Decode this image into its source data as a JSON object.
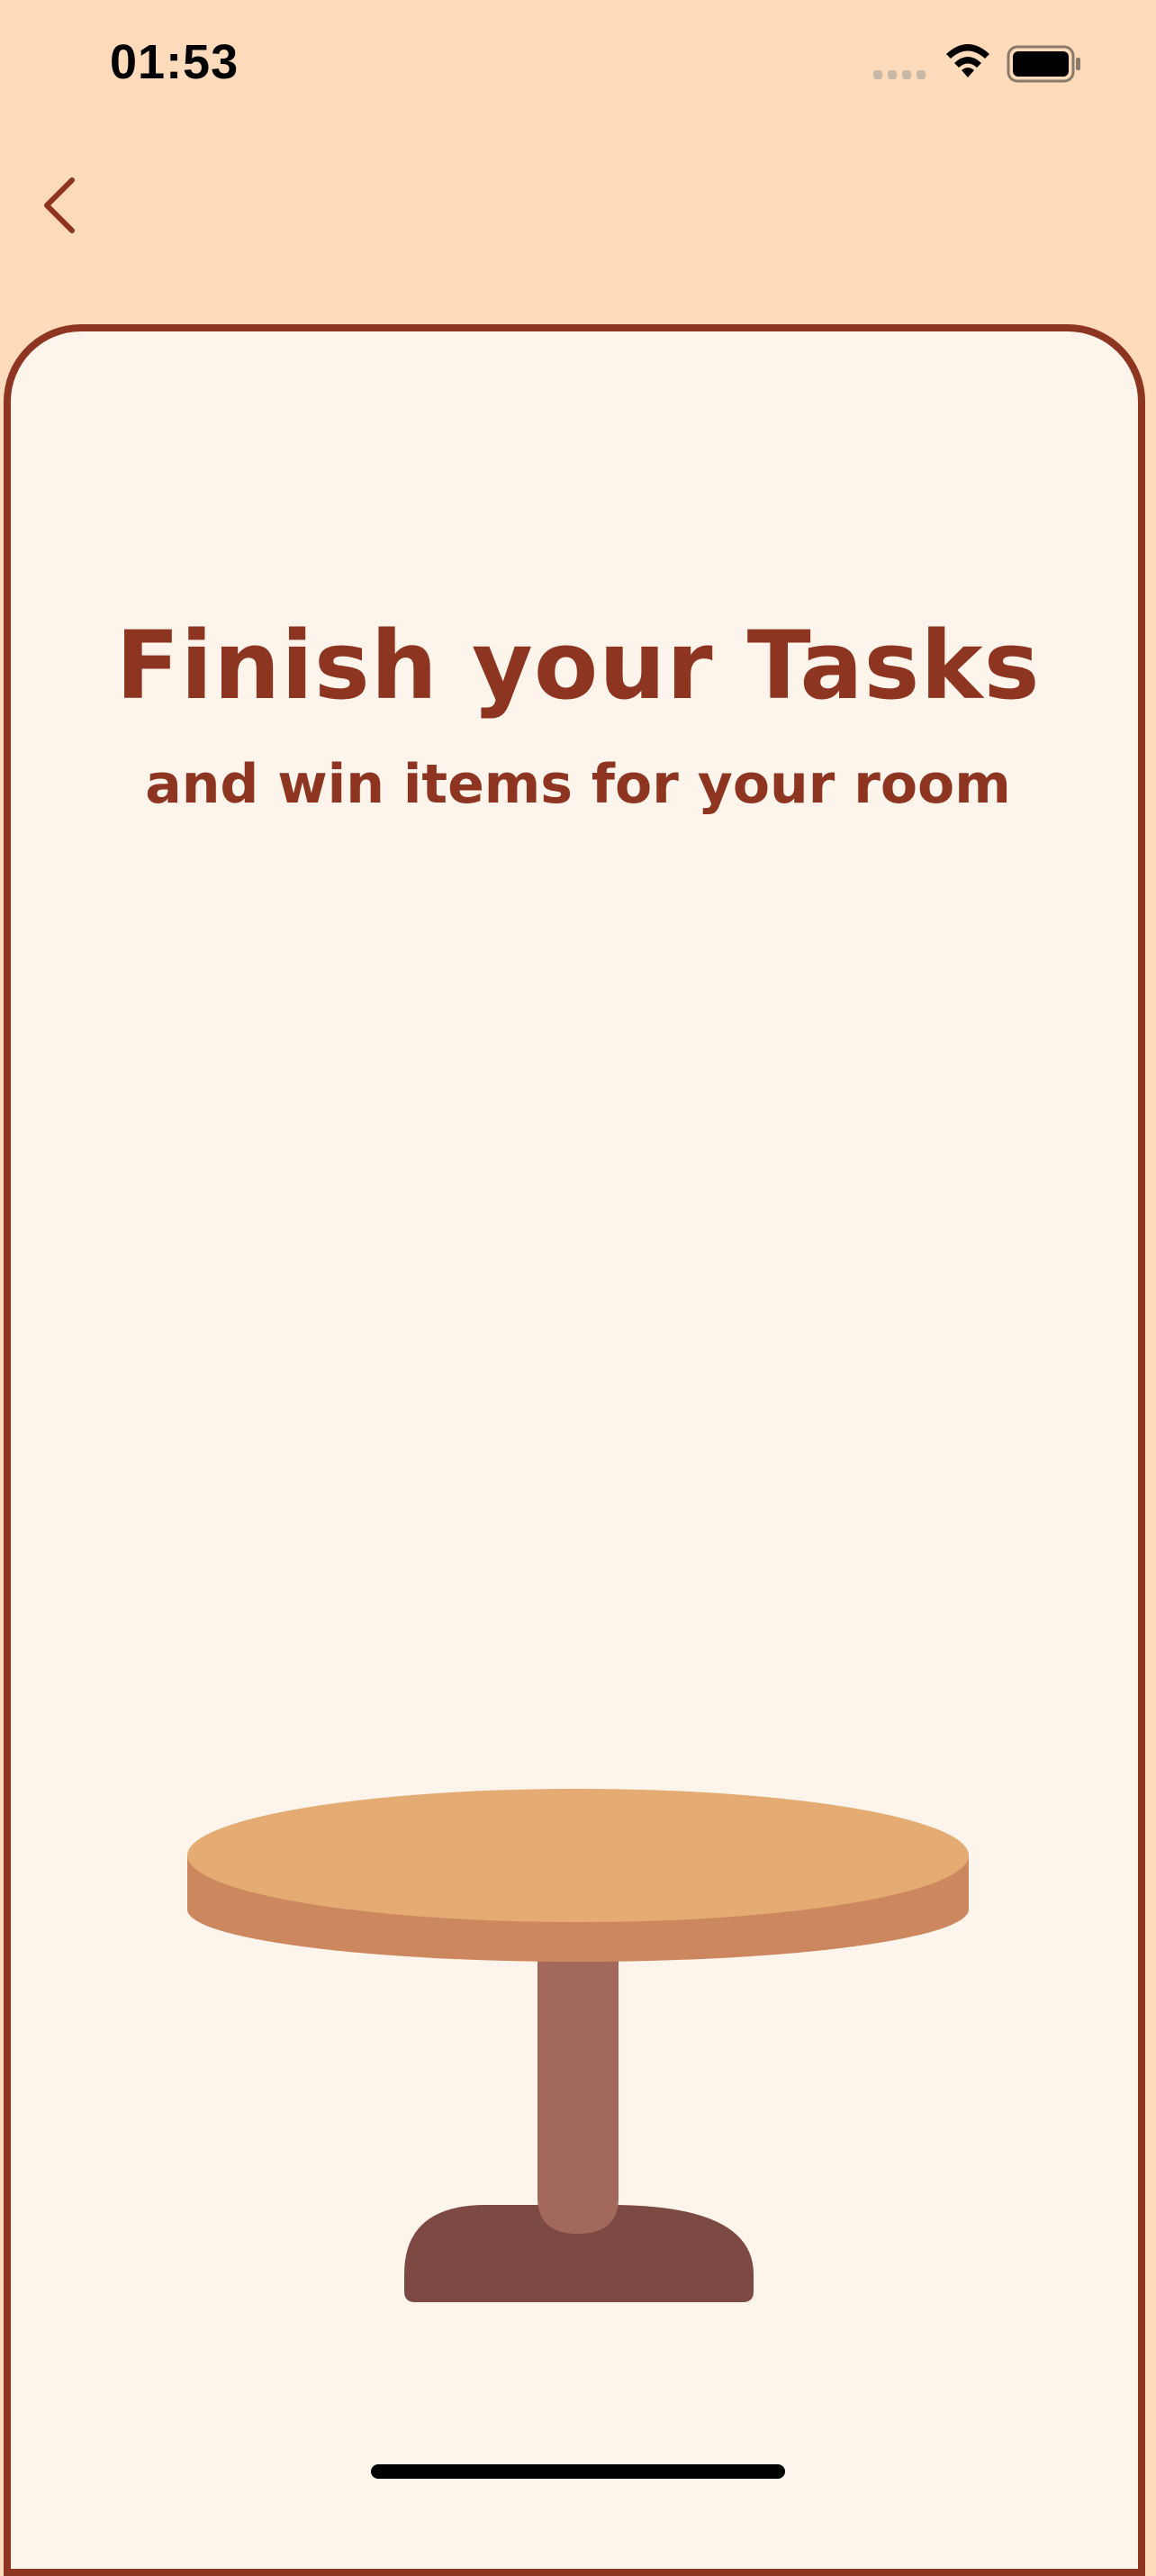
{
  "status_bar": {
    "time": "01:53"
  },
  "navigation": {
    "back_icon": "chevron-left-icon"
  },
  "content": {
    "title": "Finish your Tasks",
    "subtitle": "and win items for your room",
    "illustration": "round-table"
  },
  "colors": {
    "background": "#FFDBBB",
    "card": "#FDF4EC",
    "accent": "#8D3520",
    "table_top": "#E4AB72",
    "table_edge": "#CD875E",
    "table_leg": "#A2685C",
    "table_base": "#7C4A43"
  }
}
